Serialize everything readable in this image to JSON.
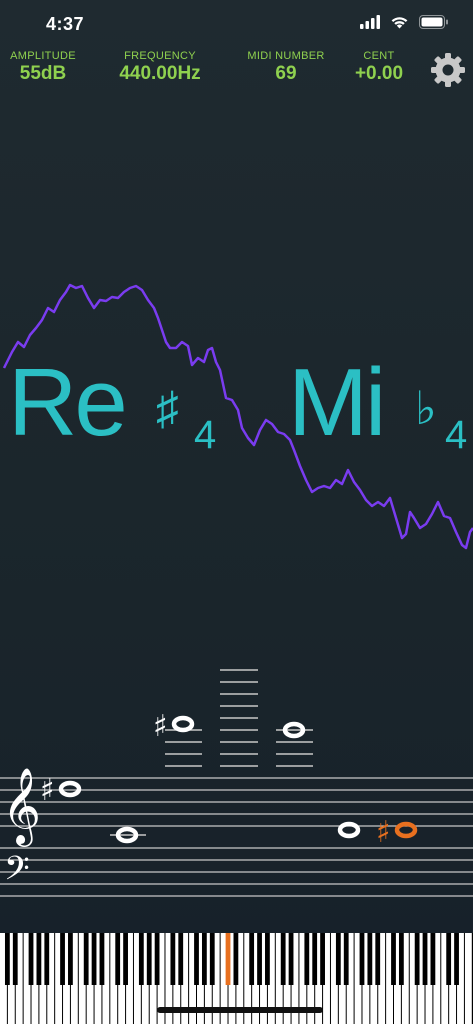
{
  "status": {
    "time": "4:37"
  },
  "metrics": [
    {
      "label": "AMPLITUDE",
      "value": "55dB"
    },
    {
      "label": "FREQUENCY",
      "value": "440.00Hz"
    },
    {
      "label": "MIDI NUMBER",
      "value": "69"
    },
    {
      "label": "CENT",
      "value": "+0.00"
    }
  ],
  "notes": {
    "primary": {
      "name": "Re",
      "accidental": "♯",
      "octave": "4"
    },
    "secondary": {
      "name": "Mi",
      "accidental": "♭",
      "octave": "4"
    }
  },
  "staff": {
    "treble_clef": "𝄞",
    "bass_clef": "𝄢",
    "sharp": "♯"
  },
  "colors": {
    "metric_green": "#8fd14f",
    "note_cyan": "#2bbfc4",
    "waveform_purple": "#7a3cf0",
    "highlight_orange": "#e8701f"
  },
  "icons": {
    "settings": "gear-icon"
  }
}
